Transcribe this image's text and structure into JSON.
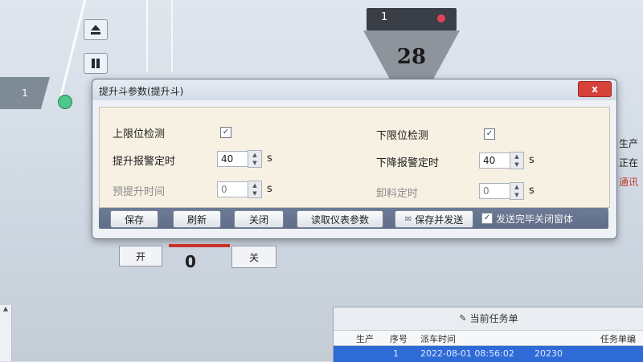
{
  "background": {
    "left_tab_label": "1",
    "funnel_id": "1",
    "funnel_count": "28",
    "right_edge_labels": [
      "生产",
      "正在",
      "通讯"
    ],
    "below_open_label": "开",
    "below_close_label": "关",
    "below_count": "0"
  },
  "dialog": {
    "title": "提升斗参数(提升斗)",
    "close_label": "x",
    "fields": {
      "upper_limit_label": "上限位检测",
      "upper_limit_checked": "✓",
      "lower_limit_label": "下限位检测",
      "lower_limit_checked": "✓",
      "lift_alarm_label": "提升报警定时",
      "lift_alarm_value": "40",
      "lift_alarm_unit": "s",
      "lower_alarm_label": "下降报警定时",
      "lower_alarm_value": "40",
      "lower_alarm_unit": "s",
      "pre_lift_label": "预提升时间",
      "pre_lift_value": "0",
      "pre_lift_unit": "s",
      "unload_label": "卸料定时",
      "unload_value": "0",
      "unload_unit": "s"
    },
    "buttons": {
      "save": "保存",
      "refresh": "刷新",
      "close": "关闭",
      "read_meter": "读取仪表参数",
      "save_send": "保存并发送",
      "close_after_send_label": "发送完毕关闭窗体",
      "close_after_send_checked": "✓"
    }
  },
  "task_panel": {
    "title": "当前任务单",
    "columns": [
      "生产",
      "序号",
      "派车时间",
      "任务单编"
    ],
    "row": [
      "",
      "1",
      "2022-08-01 08:56:02",
      "20230"
    ]
  },
  "colors": {
    "accent_blue": "#2f6bd6",
    "close_red": "#d6423a",
    "body_beige": "#f7f1e3",
    "status_green": "#4cc98a"
  }
}
